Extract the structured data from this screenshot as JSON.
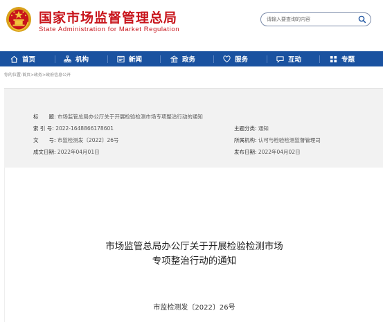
{
  "site": {
    "title_cn": "国家市场监督管理总局",
    "title_en": "State Administration for Market Regulation"
  },
  "search": {
    "placeholder": "请输入要查询的内容"
  },
  "nav": {
    "items": [
      {
        "label": "首页",
        "icon": "home-icon"
      },
      {
        "label": "机构",
        "icon": "org-icon"
      },
      {
        "label": "新闻",
        "icon": "news-icon"
      },
      {
        "label": "政务",
        "icon": "gov-icon"
      },
      {
        "label": "服务",
        "icon": "service-icon"
      },
      {
        "label": "互动",
        "icon": "interact-icon"
      },
      {
        "label": "专题",
        "icon": "topic-icon"
      }
    ]
  },
  "breadcrumb": "你的位置:首页>政务>政府信息公开",
  "meta": {
    "title_label": "标　　题:",
    "title_value": "市场监管总局办公厅关于开展检验检测市场专项整治行动的通知",
    "index_label": "索 引 号:",
    "index_value": "2022-1648866178601",
    "topic_label": "主题分类:",
    "topic_value": "通知",
    "docno_label": "文　　号:",
    "docno_value": "市监检测发〔2022〕26号",
    "org_label": "所属机构:",
    "org_value": "认可与检验检测监督管理司",
    "created_label": "成文日期:",
    "created_value": "2022年04月01日",
    "published_label": "发布日期:",
    "published_value": "2022年04月02日"
  },
  "document": {
    "title_line1": "市场监管总局办公厅关于开展检验检测市场",
    "title_line2": "专项整治行动的通知",
    "number": "市监检测发〔2022〕26号"
  },
  "colors": {
    "brand_red": "#c8141b",
    "nav_blue": "#1a52a0"
  }
}
